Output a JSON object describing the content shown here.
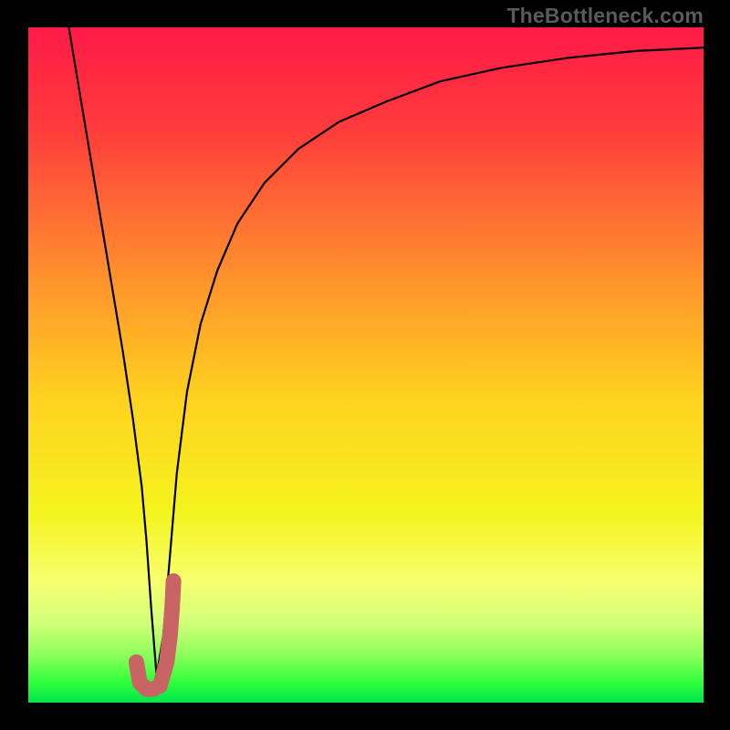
{
  "watermark": "TheBottleneck.com",
  "chart_data": {
    "type": "line",
    "title": "",
    "xlabel": "",
    "ylabel": "",
    "xlim": [
      0,
      100
    ],
    "ylim": [
      0,
      100
    ],
    "series": [
      {
        "name": "bottleneck-curve",
        "color": "#000000",
        "x": [
          6,
          8,
          10,
          12,
          14,
          15.5,
          16.8,
          17.5,
          18.2,
          19.0,
          20.0,
          21.0,
          22.0,
          23.5,
          25.5,
          28.0,
          31.0,
          35.0,
          40.0,
          46.0,
          53.0,
          61.0,
          70.0,
          80.0,
          90.0,
          100.0
        ],
        "y": [
          100,
          88,
          76,
          64,
          52,
          42,
          32,
          24,
          14,
          4,
          10,
          22,
          34,
          46,
          56,
          64,
          71,
          77,
          82,
          86,
          89,
          92,
          94,
          95.5,
          96.5,
          97.0
        ]
      },
      {
        "name": "optimal-zone-marker",
        "color": "#c86464",
        "thick": true,
        "x": [
          16.0,
          16.5,
          17.5,
          18.5,
          19.5,
          20.5,
          21.0,
          21.3,
          21.5
        ],
        "y": [
          6.0,
          3.0,
          2.0,
          2.0,
          2.5,
          6.0,
          10.0,
          14.0,
          18.0
        ]
      }
    ],
    "background_gradient": {
      "stops": [
        {
          "pos": 0.0,
          "color": "#ff1a47"
        },
        {
          "pos": 0.15,
          "color": "#ff3b3b"
        },
        {
          "pos": 0.35,
          "color": "#ff8a2e"
        },
        {
          "pos": 0.55,
          "color": "#ffd21f"
        },
        {
          "pos": 0.72,
          "color": "#f4f41e"
        },
        {
          "pos": 0.82,
          "color": "#f8ff6e"
        },
        {
          "pos": 0.88,
          "color": "#d4ff7a"
        },
        {
          "pos": 0.93,
          "color": "#8cff5a"
        },
        {
          "pos": 0.97,
          "color": "#2eff3a"
        },
        {
          "pos": 1.0,
          "color": "#00e64d"
        }
      ]
    }
  }
}
